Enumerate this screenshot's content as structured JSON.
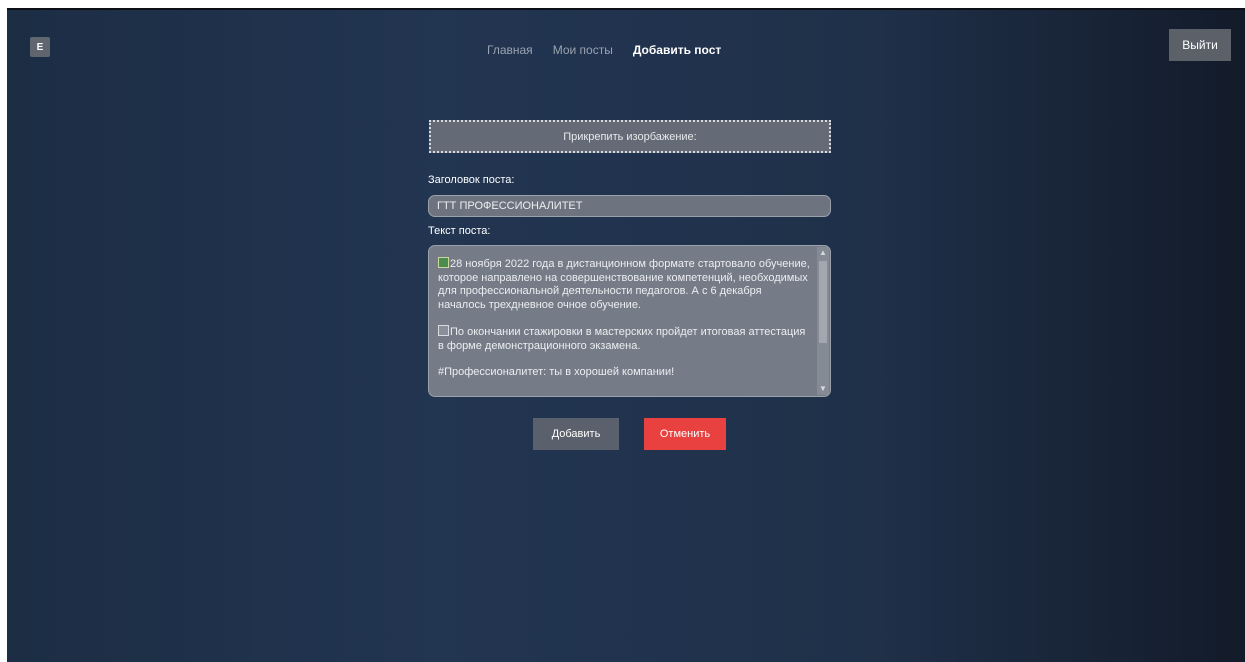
{
  "header": {
    "logo_letter": "E",
    "nav": [
      {
        "label": "Главная",
        "active": false
      },
      {
        "label": "Мои посты",
        "active": false
      },
      {
        "label": "Добавить пост",
        "active": true
      }
    ],
    "logout_label": "Выйти"
  },
  "form": {
    "attach_label": "Прикрепить изорбажение:",
    "title_label": "Заголовок поста:",
    "title_value": "ГТТ ПРОФЕССИОНАЛИТЕТ",
    "text_label": "Текст поста:",
    "text_paragraphs": [
      "28 ноября 2022 года в дистанционном формате стартовало обучение, которое направлено на совершенствование компетенций, необходимых для профессиональной деятельности педагогов. А с 6 декабря началось трехдневное очное обучение.",
      "По окончании стажировки в мастерских пройдет итоговая аттестация в форме демонстрационного экзамена.",
      "#Профессионалитет: ты в хорошей компании!"
    ],
    "add_button": "Добавить",
    "cancel_button": "Отменить"
  },
  "colors": {
    "accent_cancel": "#e8413f",
    "button_gray": "#5b616c",
    "background_dark": "#1f3049"
  },
  "icons": {
    "paragraph_1_icon": "calendar-emoji-icon",
    "paragraph_2_icon": "notebook-emoji-icon"
  }
}
